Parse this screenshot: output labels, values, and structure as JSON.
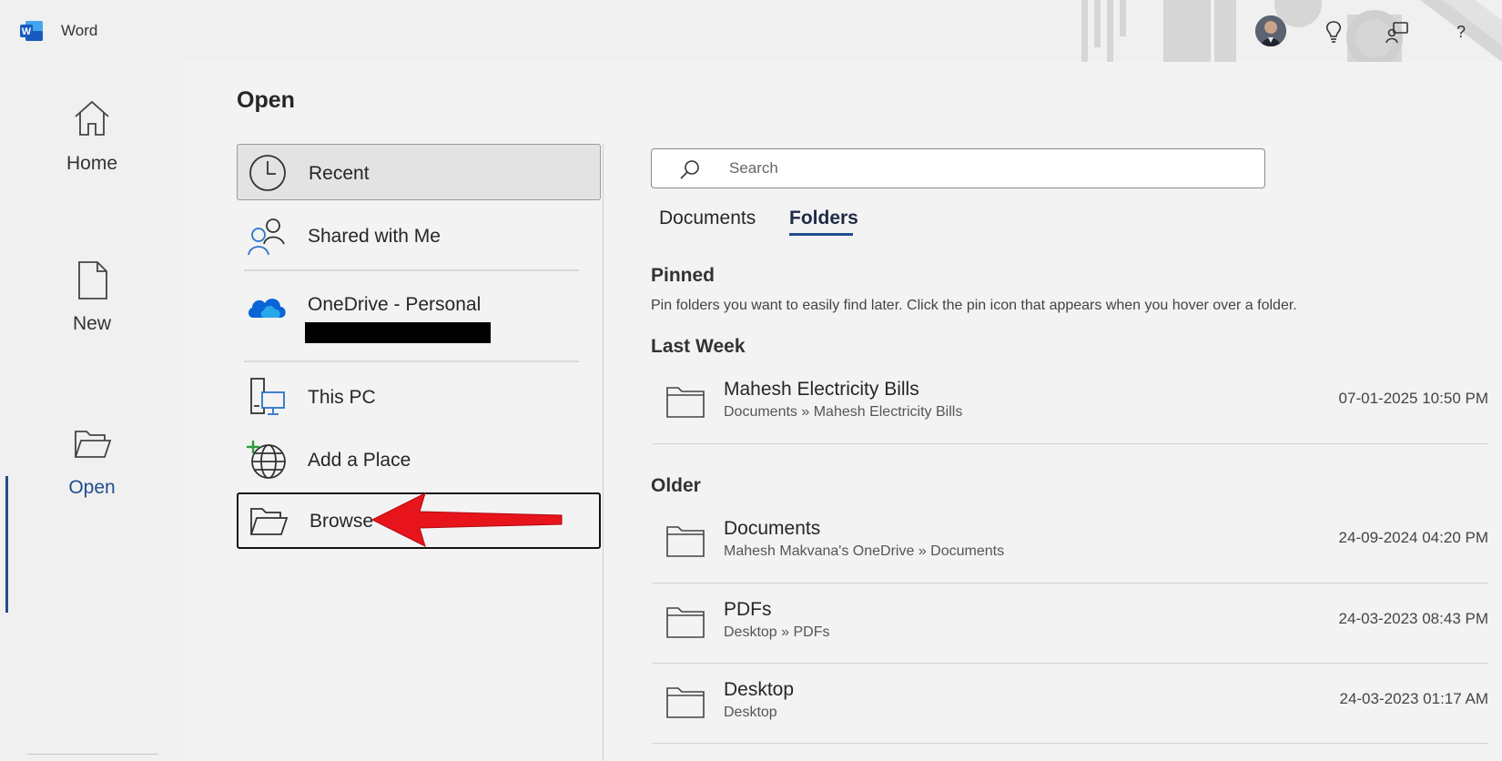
{
  "app": {
    "name": "Word"
  },
  "title_icons": [
    "account-avatar",
    "lightbulb-icon",
    "feedback-icon",
    "help-icon"
  ],
  "help_label": "?",
  "nav": {
    "items": [
      {
        "label": "Home",
        "icon": "home-icon"
      },
      {
        "label": "New",
        "icon": "new-document-icon"
      },
      {
        "label": "Open",
        "icon": "open-folder-icon",
        "active": true
      }
    ]
  },
  "page_title": "Open",
  "locations": {
    "items": [
      {
        "label": "Recent",
        "icon": "clock-icon",
        "selected": true
      },
      {
        "label": "Shared with Me",
        "icon": "people-icon"
      },
      {
        "label": "OneDrive - Personal",
        "icon": "onedrive-cloud-icon"
      },
      {
        "label": "This PC",
        "icon": "pc-icon"
      },
      {
        "label": "Add a Place",
        "icon": "add-place-globe-icon"
      },
      {
        "label": "Browse",
        "icon": "browse-folder-icon",
        "highlighted": true
      }
    ]
  },
  "search": {
    "placeholder": "Search"
  },
  "tabs": [
    {
      "label": "Documents",
      "active": false
    },
    {
      "label": "Folders",
      "active": true
    }
  ],
  "pinned": {
    "heading": "Pinned",
    "description": "Pin folders you want to easily find later. Click the pin icon that appears when you hover over a folder."
  },
  "last_week": {
    "heading": "Last Week",
    "rows": [
      {
        "name": "Mahesh Electricity Bills",
        "path": "Documents » Mahesh Electricity Bills",
        "date": "07-01-2025 10:50 PM"
      }
    ]
  },
  "older": {
    "heading": "Older",
    "rows": [
      {
        "name": "Documents",
        "path": "Mahesh Makvana's OneDrive » Documents",
        "date": "24-09-2024 04:20 PM"
      },
      {
        "name": "PDFs",
        "path": "Desktop » PDFs",
        "date": "24-03-2023 08:43 PM"
      },
      {
        "name": "Desktop",
        "path": "Desktop",
        "date": "24-03-2023 01:17 AM"
      }
    ]
  },
  "colors": {
    "accent": "#1f4e8c",
    "word_blue": "#185abd",
    "arrow_red": "#e8141c"
  }
}
